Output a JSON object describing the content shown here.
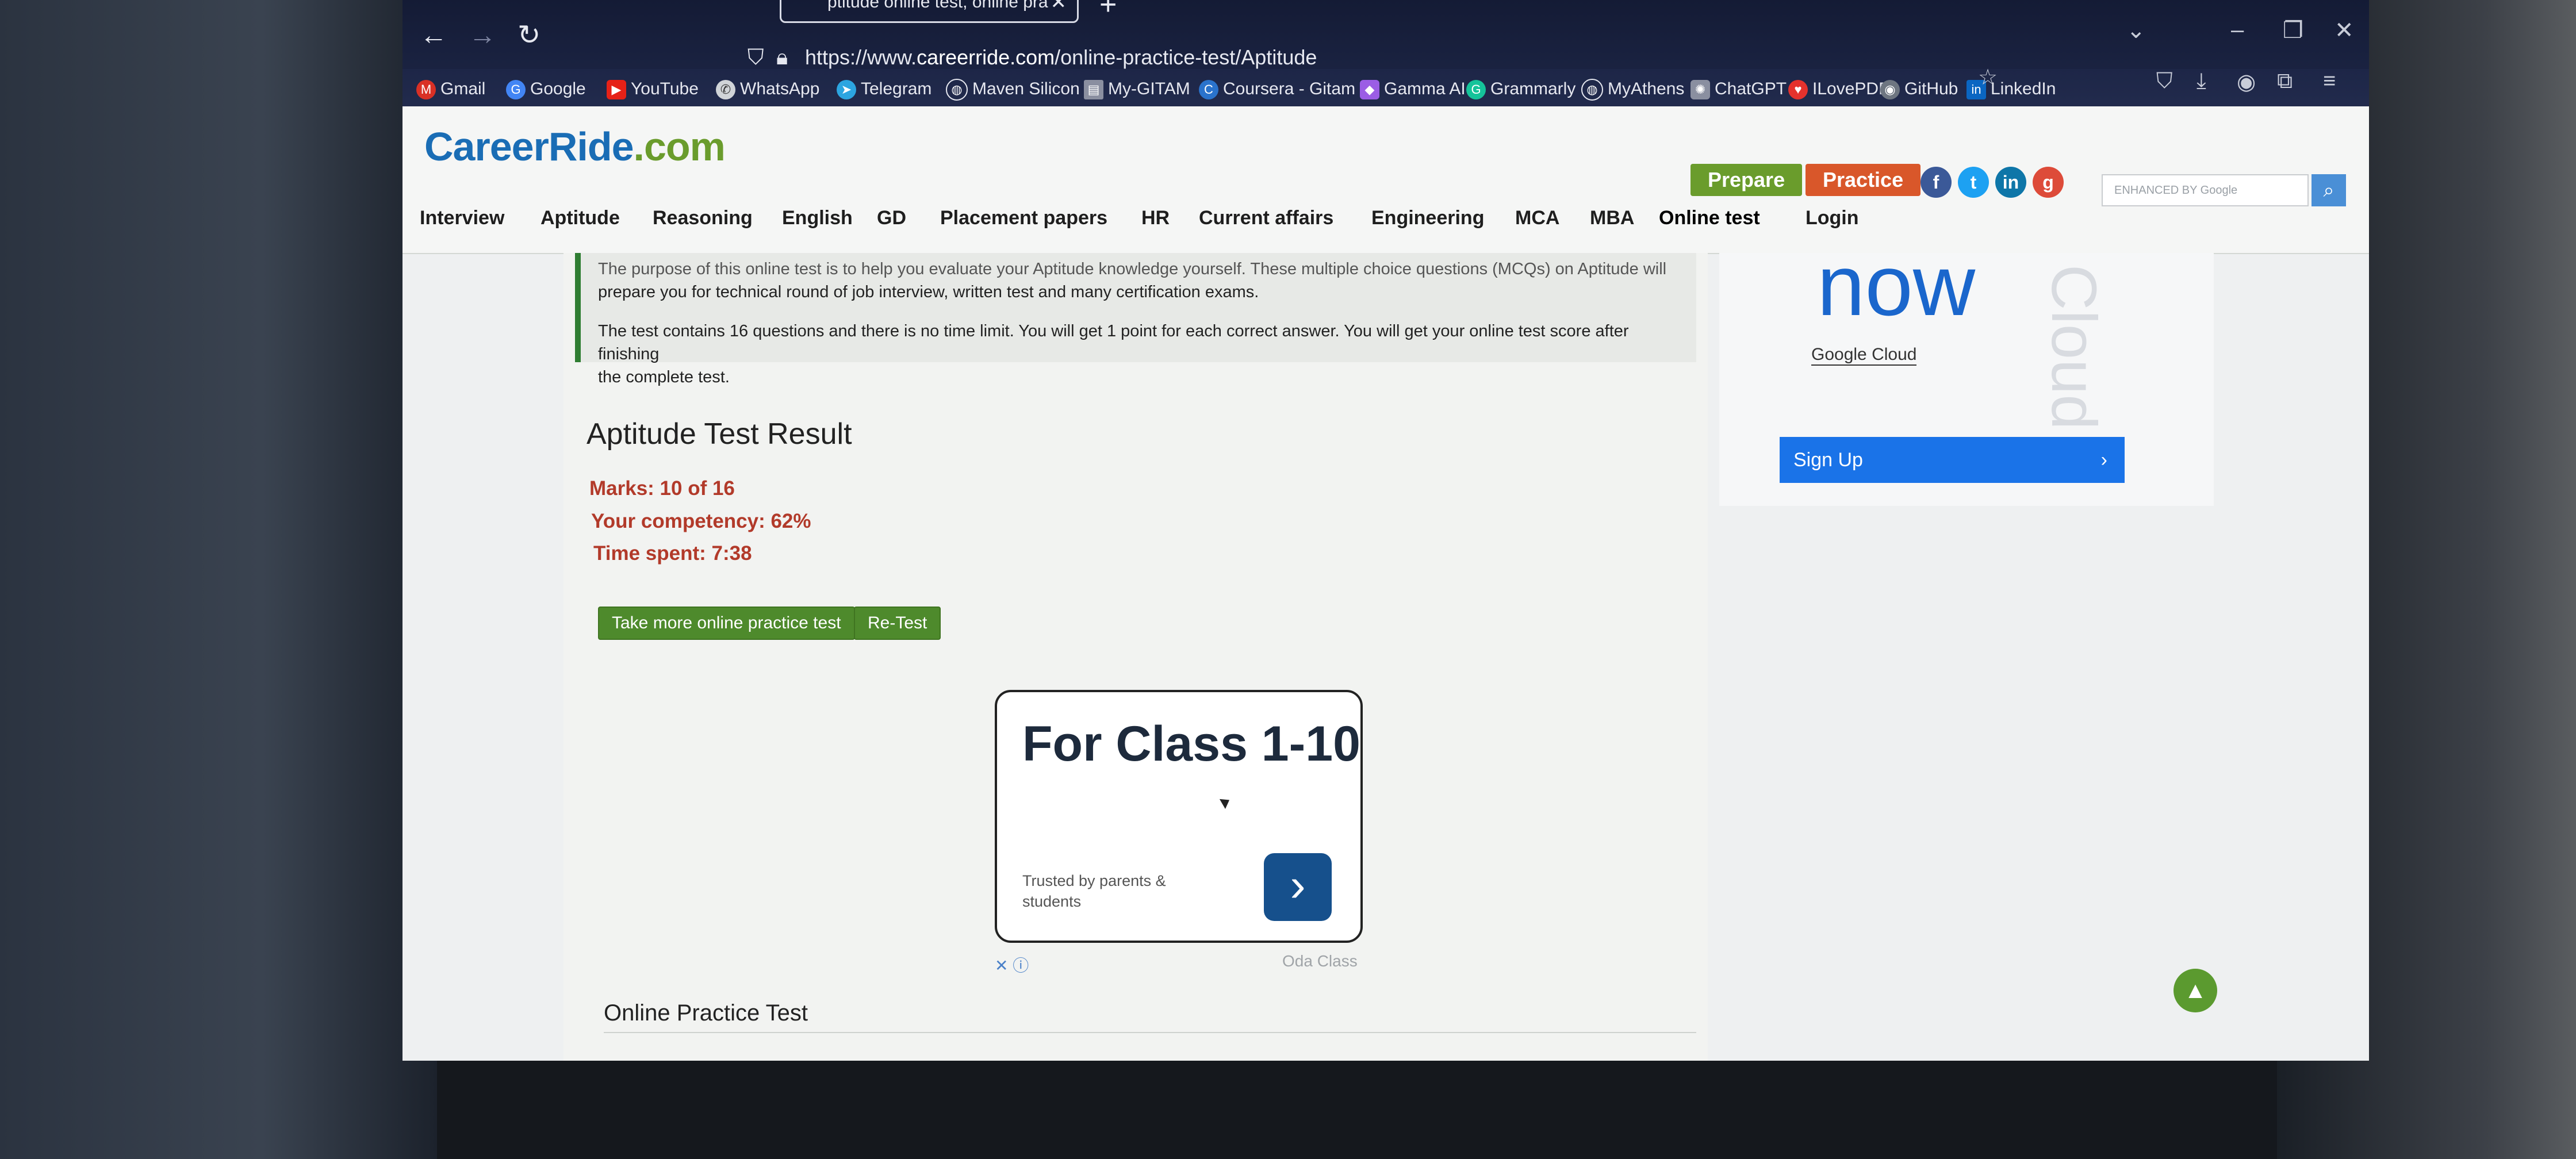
{
  "browser": {
    "tab_title": "ptitude online test, online pra",
    "url_prefix": "https://www.",
    "url_host": "careerride.com",
    "url_path": "/online-practice-test/Aptitude",
    "bookmarks": [
      "Gmail",
      "Google",
      "YouTube",
      "WhatsApp",
      "Telegram",
      "Maven Silicon",
      "My-GITAM",
      "Coursera - Gitam",
      "Gamma AI",
      "Grammarly",
      "MyAthens",
      "ChatGPT",
      "ILovePDF",
      "GitHub",
      "LinkedIn"
    ]
  },
  "site": {
    "logo_main": "CareerRide",
    "logo_tld": ".com",
    "prepare": "Prepare",
    "practice": "Practice",
    "search_placeholder": "ENHANCED BY Google",
    "menu": [
      "Interview",
      "Aptitude",
      "Reasoning",
      "English",
      "GD",
      "Placement papers",
      "HR",
      "Current affairs",
      "Engineering",
      "MCA",
      "MBA",
      "Online test",
      "Login"
    ]
  },
  "intro": {
    "line1": "The purpose of this online test is to help you evaluate your Aptitude knowledge yourself. These multiple choice questions (MCQs) on Aptitude will",
    "line2": "prepare you for technical round of job interview, written test and many certification exams.",
    "line3": "The test contains 16 questions and there is no time limit. You will get 1 point for each correct answer. You will get your online test score after finishing",
    "line4": "the complete test."
  },
  "result": {
    "title": "Aptitude Test Result",
    "marks": "Marks: 10 of 16",
    "competency": "Your competency: 62%",
    "time": "Time spent: 7:38",
    "more_btn": "Take more online practice test",
    "retest_btn": "Re-Test"
  },
  "ad": {
    "headline": "For Class 1-10",
    "sub": "Trusted by parents & students",
    "brand": "Oda Class",
    "close": "✕ ⓘ"
  },
  "side_ad": {
    "big": "now",
    "brand": "Google Cloud",
    "vertical": "Cloud",
    "signup": "Sign Up"
  },
  "footer": {
    "section_title": "Online Practice Test"
  }
}
